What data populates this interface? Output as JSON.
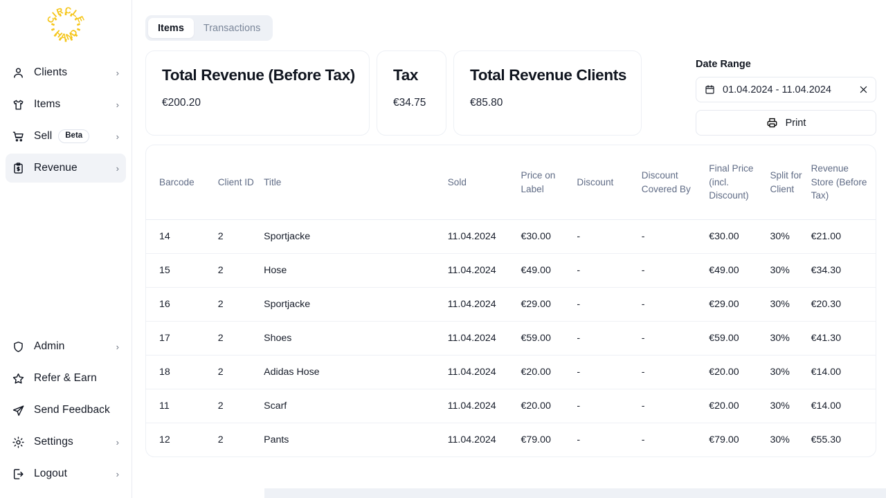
{
  "brand": {
    "logo_text_top": "CIRCLE",
    "logo_text_bottom": "HAND",
    "logo_color": "#F5C518"
  },
  "sidebar": {
    "top_items": [
      {
        "label": "Clients",
        "icon": "user-icon",
        "chevron": "›",
        "has_chevron": true,
        "active": false,
        "badge": ""
      },
      {
        "label": "Items",
        "icon": "tshirt-icon",
        "chevron": "›",
        "has_chevron": true,
        "active": false,
        "badge": ""
      },
      {
        "label": "Sell",
        "icon": "cart-icon",
        "chevron": "›",
        "has_chevron": true,
        "active": false,
        "badge": "Beta"
      },
      {
        "label": "Revenue",
        "icon": "clipboard-money-icon",
        "chevron": "›",
        "has_chevron": true,
        "active": true,
        "badge": ""
      }
    ],
    "bottom_items": [
      {
        "label": "Admin",
        "icon": "shield-icon",
        "chevron": "›",
        "has_chevron": true,
        "badge": ""
      },
      {
        "label": "Refer & Earn",
        "icon": "star-icon",
        "chevron": "",
        "has_chevron": false,
        "badge": ""
      },
      {
        "label": "Send Feedback",
        "icon": "send-icon",
        "chevron": "",
        "has_chevron": false,
        "badge": ""
      },
      {
        "label": "Settings",
        "icon": "gear-icon",
        "chevron": "›",
        "has_chevron": true,
        "badge": ""
      },
      {
        "label": "Logout",
        "icon": "logout-icon",
        "chevron": "›",
        "has_chevron": true,
        "badge": ""
      }
    ]
  },
  "tabs": [
    {
      "label": "Items",
      "active": true
    },
    {
      "label": "Transactions",
      "active": false
    }
  ],
  "stats": [
    {
      "title": "Total Revenue (Before Tax)",
      "value": "€200.20"
    },
    {
      "title": "Tax",
      "value": "€34.75"
    },
    {
      "title": "Total Revenue Clients",
      "value": "€85.80"
    }
  ],
  "date_range": {
    "label": "Date Range",
    "value": "01.04.2024 - 11.04.2024",
    "calendar_icon": "calendar-icon",
    "clear_icon": "close-icon"
  },
  "print": {
    "label": "Print",
    "icon": "printer-icon"
  },
  "table": {
    "columns": [
      "Barcode",
      "Client ID",
      "Title",
      "Sold",
      "Price on Label",
      "Discount",
      "Discount Covered By",
      "Final Price (incl. Discount)",
      "Split for Client",
      "Revenue Store (Before Tax)"
    ],
    "rows": [
      {
        "barcode": "14",
        "client_id": "2",
        "title": "Sportjacke",
        "sold": "11.04.2024",
        "price_label": "€30.00",
        "discount": "-",
        "discount_covered_by": "-",
        "final_price": "€30.00",
        "split_for_client": "30%",
        "revenue_store": "€21.00"
      },
      {
        "barcode": "15",
        "client_id": "2",
        "title": "Hose",
        "sold": "11.04.2024",
        "price_label": "€49.00",
        "discount": "-",
        "discount_covered_by": "-",
        "final_price": "€49.00",
        "split_for_client": "30%",
        "revenue_store": "€34.30"
      },
      {
        "barcode": "16",
        "client_id": "2",
        "title": "Sportjacke",
        "sold": "11.04.2024",
        "price_label": "€29.00",
        "discount": "-",
        "discount_covered_by": "-",
        "final_price": "€29.00",
        "split_for_client": "30%",
        "revenue_store": "€20.30"
      },
      {
        "barcode": "17",
        "client_id": "2",
        "title": "Shoes",
        "sold": "11.04.2024",
        "price_label": "€59.00",
        "discount": "-",
        "discount_covered_by": "-",
        "final_price": "€59.00",
        "split_for_client": "30%",
        "revenue_store": "€41.30"
      },
      {
        "barcode": "18",
        "client_id": "2",
        "title": "Adidas Hose",
        "sold": "11.04.2024",
        "price_label": "€20.00",
        "discount": "-",
        "discount_covered_by": "-",
        "final_price": "€20.00",
        "split_for_client": "30%",
        "revenue_store": "€14.00"
      },
      {
        "barcode": "11",
        "client_id": "2",
        "title": "Scarf",
        "sold": "11.04.2024",
        "price_label": "€20.00",
        "discount": "-",
        "discount_covered_by": "-",
        "final_price": "€20.00",
        "split_for_client": "30%",
        "revenue_store": "€14.00"
      },
      {
        "barcode": "12",
        "client_id": "2",
        "title": "Pants",
        "sold": "11.04.2024",
        "price_label": "€79.00",
        "discount": "-",
        "discount_covered_by": "-",
        "final_price": "€79.00",
        "split_for_client": "30%",
        "revenue_store": "€55.30"
      }
    ]
  },
  "colors": {
    "accent": "#F5C518",
    "text": "#10151f",
    "muted": "#5f6b85",
    "border": "#edf0f5",
    "panel": "#eef1f6"
  }
}
